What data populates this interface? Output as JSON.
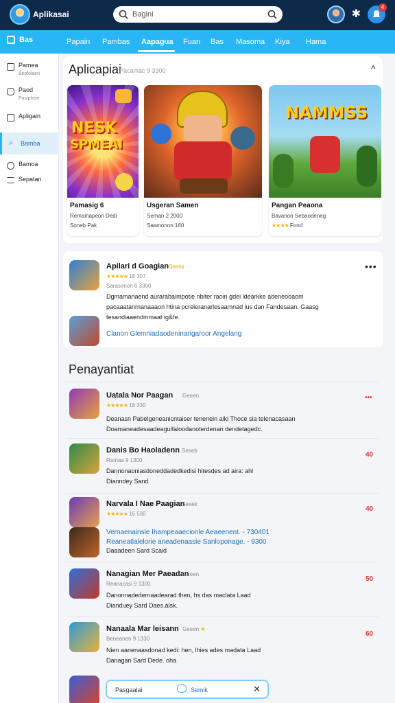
{
  "header": {
    "app_name": "Aplikasai",
    "search_placeholder": "Bagini",
    "notification_count": "4",
    "star_glyph": "✱"
  },
  "nav": {
    "home_label": "Bas",
    "items": [
      "Papain",
      "Pambas",
      "Aapagua",
      "Fuan",
      "Bas",
      "Masoma",
      "Kiya",
      "Hama"
    ],
    "active_index": 2
  },
  "sidebar": {
    "items": [
      {
        "label": "Pamea",
        "sub": "Beplolaen",
        "icon": "joystick-icon"
      },
      {
        "label": "Paod",
        "sub": "Pasiplase",
        "icon": "lock-icon"
      },
      {
        "label": "Apligain",
        "sub": "",
        "icon": "list-icon"
      },
      {
        "label": "Bamba",
        "sub": "",
        "icon": "tag-icon",
        "active": true
      },
      {
        "label": "Bamoa",
        "sub": "",
        "icon": "search-icon"
      },
      {
        "label": "Sepatan",
        "sub": "",
        "icon": "menu-icon"
      }
    ]
  },
  "featured": {
    "title": "Aplicapiai",
    "meta": "Pacamac 9 3300",
    "collapse_glyph": "^",
    "cards": [
      {
        "art_text_1": "NESK",
        "art_text_2": "SPMEAI",
        "title": "Pamasig 6",
        "developer": "Remainapeon Dedi",
        "rating": "Soneb Pak"
      },
      {
        "art_text_1": "",
        "art_text_2": "",
        "title": "Usgeran Samen",
        "developer": "Seman 2 2000",
        "rating": "Saamonon 160"
      },
      {
        "art_text_1": "NAMMSS",
        "art_text_2": "",
        "title": "Pangan Peaona",
        "developer": "Bavanon Sebaodeneg",
        "rating": "Fond"
      }
    ]
  },
  "highlight": {
    "title": "Apilari d Goagian",
    "badge": "Seens",
    "rating_value": "18 307",
    "meta": "Sarasenon 6 3300",
    "description": "Dgmamanaend aurarabaimpotie nbiter raoin gdei ldearkke adeneooaom pacaaatanrnanaaaon htina pcreleranarlesaamnad lus dan Fandesaan. Gaasg tesandiaaendmmaat ig&fe.",
    "link": "Clanon Glemniadaodeninarigaroor Angelang",
    "more_glyph": "•••"
  },
  "list": {
    "title": "Penayantiat",
    "items": [
      {
        "title": "Uatala Nor Paagan",
        "badge": "Geeen",
        "rating": "18 330",
        "desc_1": "Deanasn Pabelgeneanicntaiser tenenein aiki Thoce sia telenacasaan",
        "desc_2": "Doamaneadesaadeaguifaloodanoterdenan dendetagedc.",
        "action": "•••",
        "stars": true
      },
      {
        "title": "Danis Bo Haoladenn",
        "badge": "Seseb",
        "rating": "Ramaa 9 1300",
        "desc_1": "Dannonaoniasdoneddadedkedisi hitesdes ad aira: ahl",
        "desc_2": "Dianndey Sand",
        "action": "40",
        "stars": false
      },
      {
        "title": "Narvala I Nae Paagian",
        "badge": "Seeek",
        "rating": "16 530",
        "desc_1": "Vernaenainsle Ihampeaaecionle Aeaeenent. - 730401",
        "desc_2": "Reaneatlalelorie aneadenaasie Sanloponage. - 9300",
        "desc_3": "Daaadeen Sard Scaid",
        "action": "40",
        "stars": true,
        "link_style": true
      },
      {
        "title": "Nanagian Mer Paeadan",
        "badge": "Geeen",
        "rating": "Reanacasi 9 1300",
        "desc_1": "Danonnadedernaadearad then, hs das maclata Laad",
        "desc_2": "Dianduey Sard Daes.alsk.",
        "action": "50",
        "stars": false
      },
      {
        "title": "Nanaala Mar leisann",
        "badge": "Geeen",
        "rating": "Beneanen 9 1330",
        "desc_1": "Nien aanenaasdonad kedi: hen, lhies ades madata Laad",
        "desc_2": "Danagan Sard Dede. oha",
        "action": "60",
        "stars": false
      }
    ]
  },
  "bottom_bar": {
    "placeholder": "Pasgaalai",
    "label": "Semik",
    "close_glyph": "✕"
  }
}
